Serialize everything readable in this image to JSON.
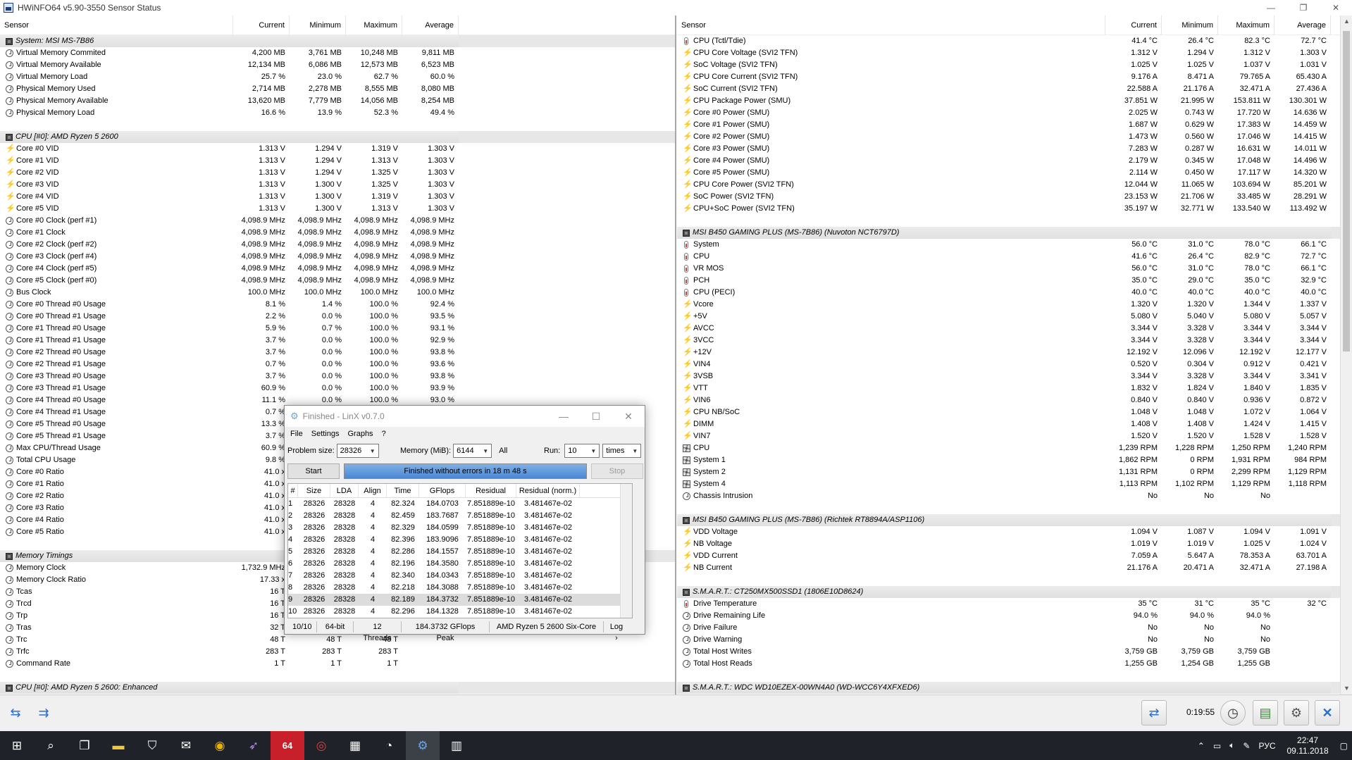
{
  "window": {
    "title": "HWiNFO64 v5.90-3550 Sensor Status",
    "buttons": [
      "—",
      "❐",
      "✕"
    ]
  },
  "columns": [
    "Sensor",
    "Current",
    "Minimum",
    "Maximum",
    "Average"
  ],
  "left_rows": [
    {
      "type": "section",
      "label": "System: MSI MS-7B86",
      "icon": "chip"
    },
    {
      "label": "Virtual Memory Commited",
      "icon": "clock",
      "v": [
        "4,200 MB",
        "3,761 MB",
        "10,248 MB",
        "9,811 MB"
      ]
    },
    {
      "label": "Virtual Memory Available",
      "icon": "clock",
      "v": [
        "12,134 MB",
        "6,086 MB",
        "12,573 MB",
        "6,523 MB"
      ]
    },
    {
      "label": "Virtual Memory Load",
      "icon": "clock",
      "v": [
        "25.7 %",
        "23.0 %",
        "62.7 %",
        "60.0 %"
      ]
    },
    {
      "label": "Physical Memory Used",
      "icon": "clock",
      "v": [
        "2,714 MB",
        "2,278 MB",
        "8,555 MB",
        "8,080 MB"
      ]
    },
    {
      "label": "Physical Memory Available",
      "icon": "clock",
      "v": [
        "13,620 MB",
        "7,779 MB",
        "14,056 MB",
        "8,254 MB"
      ]
    },
    {
      "label": "Physical Memory Load",
      "icon": "clock",
      "v": [
        "16.6 %",
        "13.9 %",
        "52.3 %",
        "49.4 %"
      ]
    },
    {
      "type": "blank"
    },
    {
      "type": "section",
      "label": "CPU [#0]: AMD Ryzen 5 2600",
      "icon": "chip"
    },
    {
      "label": "Core #0 VID",
      "icon": "bolt",
      "v": [
        "1.313 V",
        "1.294 V",
        "1.319 V",
        "1.303 V"
      ]
    },
    {
      "label": "Core #1 VID",
      "icon": "bolt",
      "v": [
        "1.313 V",
        "1.294 V",
        "1.313 V",
        "1.303 V"
      ]
    },
    {
      "label": "Core #2 VID",
      "icon": "bolt",
      "v": [
        "1.313 V",
        "1.294 V",
        "1.325 V",
        "1.303 V"
      ]
    },
    {
      "label": "Core #3 VID",
      "icon": "bolt",
      "v": [
        "1.313 V",
        "1.300 V",
        "1.325 V",
        "1.303 V"
      ]
    },
    {
      "label": "Core #4 VID",
      "icon": "bolt",
      "v": [
        "1.313 V",
        "1.300 V",
        "1.319 V",
        "1.303 V"
      ]
    },
    {
      "label": "Core #5 VID",
      "icon": "bolt",
      "v": [
        "1.313 V",
        "1.300 V",
        "1.313 V",
        "1.303 V"
      ]
    },
    {
      "label": "Core #0 Clock (perf #1)",
      "icon": "clock",
      "v": [
        "4,098.9 MHz",
        "4,098.9 MHz",
        "4,098.9 MHz",
        "4,098.9 MHz"
      ]
    },
    {
      "label": "Core #1 Clock",
      "icon": "clock",
      "v": [
        "4,098.9 MHz",
        "4,098.9 MHz",
        "4,098.9 MHz",
        "4,098.9 MHz"
      ]
    },
    {
      "label": "Core #2 Clock (perf #2)",
      "icon": "clock",
      "v": [
        "4,098.9 MHz",
        "4,098.9 MHz",
        "4,098.9 MHz",
        "4,098.9 MHz"
      ]
    },
    {
      "label": "Core #3 Clock (perf #4)",
      "icon": "clock",
      "v": [
        "4,098.9 MHz",
        "4,098.9 MHz",
        "4,098.9 MHz",
        "4,098.9 MHz"
      ]
    },
    {
      "label": "Core #4 Clock (perf #5)",
      "icon": "clock",
      "v": [
        "4,098.9 MHz",
        "4,098.9 MHz",
        "4,098.9 MHz",
        "4,098.9 MHz"
      ]
    },
    {
      "label": "Core #5 Clock (perf #0)",
      "icon": "clock",
      "v": [
        "4,098.9 MHz",
        "4,098.9 MHz",
        "4,098.9 MHz",
        "4,098.9 MHz"
      ]
    },
    {
      "label": "Bus Clock",
      "icon": "clock",
      "v": [
        "100.0 MHz",
        "100.0 MHz",
        "100.0 MHz",
        "100.0 MHz"
      ]
    },
    {
      "label": "Core #0 Thread #0 Usage",
      "icon": "clock",
      "v": [
        "8.1 %",
        "1.4 %",
        "100.0 %",
        "92.4 %"
      ]
    },
    {
      "label": "Core #0 Thread #1 Usage",
      "icon": "clock",
      "v": [
        "2.2 %",
        "0.0 %",
        "100.0 %",
        "93.5 %"
      ]
    },
    {
      "label": "Core #1 Thread #0 Usage",
      "icon": "clock",
      "v": [
        "5.9 %",
        "0.7 %",
        "100.0 %",
        "93.1 %"
      ]
    },
    {
      "label": "Core #1 Thread #1 Usage",
      "icon": "clock",
      "v": [
        "3.7 %",
        "0.0 %",
        "100.0 %",
        "92.9 %"
      ]
    },
    {
      "label": "Core #2 Thread #0 Usage",
      "icon": "clock",
      "v": [
        "3.7 %",
        "0.0 %",
        "100.0 %",
        "93.8 %"
      ]
    },
    {
      "label": "Core #2 Thread #1 Usage",
      "icon": "clock",
      "v": [
        "0.7 %",
        "0.0 %",
        "100.0 %",
        "93.6 %"
      ]
    },
    {
      "label": "Core #3 Thread #0 Usage",
      "icon": "clock",
      "v": [
        "3.7 %",
        "0.0 %",
        "100.0 %",
        "93.8 %"
      ]
    },
    {
      "label": "Core #3 Thread #1 Usage",
      "icon": "clock",
      "v": [
        "60.9 %",
        "0.0 %",
        "100.0 %",
        "93.9 %"
      ]
    },
    {
      "label": "Core #4 Thread #0 Usage",
      "icon": "clock",
      "v": [
        "11.1 %",
        "0.0 %",
        "100.0 %",
        "93.0 %"
      ]
    },
    {
      "label": "Core #4 Thread #1 Usage",
      "icon": "clock",
      "v": [
        "0.7 %",
        "",
        "",
        ""
      ]
    },
    {
      "label": "Core #5 Thread #0 Usage",
      "icon": "clock",
      "v": [
        "13.3 %",
        "",
        "",
        ""
      ]
    },
    {
      "label": "Core #5 Thread #1 Usage",
      "icon": "clock",
      "v": [
        "3.7 %",
        "",
        "",
        ""
      ]
    },
    {
      "label": "Max CPU/Thread Usage",
      "icon": "clock",
      "v": [
        "60.9 %",
        "",
        "",
        ""
      ]
    },
    {
      "label": "Total CPU Usage",
      "icon": "clock",
      "v": [
        "9.8 %",
        "",
        "",
        ""
      ]
    },
    {
      "label": "Core #0 Ratio",
      "icon": "clock",
      "v": [
        "41.0 x",
        "",
        "",
        ""
      ]
    },
    {
      "label": "Core #1 Ratio",
      "icon": "clock",
      "v": [
        "41.0 x",
        "",
        "",
        ""
      ]
    },
    {
      "label": "Core #2 Ratio",
      "icon": "clock",
      "v": [
        "41.0 x",
        "",
        "",
        ""
      ]
    },
    {
      "label": "Core #3 Ratio",
      "icon": "clock",
      "v": [
        "41.0 x",
        "",
        "",
        ""
      ]
    },
    {
      "label": "Core #4 Ratio",
      "icon": "clock",
      "v": [
        "41.0 x",
        "",
        "",
        ""
      ]
    },
    {
      "label": "Core #5 Ratio",
      "icon": "clock",
      "v": [
        "41.0 x",
        "",
        "",
        ""
      ]
    },
    {
      "type": "blank"
    },
    {
      "type": "section",
      "label": "Memory Timings",
      "icon": "chip"
    },
    {
      "label": "Memory Clock",
      "icon": "clock",
      "v": [
        "1,732.9 MHz",
        "",
        "",
        ""
      ]
    },
    {
      "label": "Memory Clock Ratio",
      "icon": "clock",
      "v": [
        "17.33 x",
        "",
        "",
        ""
      ]
    },
    {
      "label": "Tcas",
      "icon": "clock",
      "v": [
        "16 T",
        "",
        "",
        ""
      ]
    },
    {
      "label": "Trcd",
      "icon": "clock",
      "v": [
        "16 T",
        "",
        "",
        ""
      ]
    },
    {
      "label": "Trp",
      "icon": "clock",
      "v": [
        "16 T",
        "",
        "",
        ""
      ]
    },
    {
      "label": "Tras",
      "icon": "clock",
      "v": [
        "32 T",
        "",
        "",
        ""
      ]
    },
    {
      "label": "Trc",
      "icon": "clock",
      "v": [
        "48 T",
        "48 T",
        "48 T",
        ""
      ]
    },
    {
      "label": "Trfc",
      "icon": "clock",
      "v": [
        "283 T",
        "283 T",
        "283 T",
        ""
      ]
    },
    {
      "label": "Command Rate",
      "icon": "clock",
      "v": [
        "1 T",
        "1 T",
        "1 T",
        ""
      ]
    },
    {
      "type": "blank"
    },
    {
      "type": "section",
      "label": "CPU [#0]: AMD Ryzen 5 2600: Enhanced",
      "icon": "chip"
    }
  ],
  "right_rows": [
    {
      "label": "CPU (Tctl/Tdie)",
      "icon": "therm",
      "v": [
        "41.4 °C",
        "26.4 °C",
        "82.3 °C",
        "72.7 °C"
      ]
    },
    {
      "label": "CPU Core Voltage (SVI2 TFN)",
      "icon": "bolt",
      "v": [
        "1.312 V",
        "1.294 V",
        "1.312 V",
        "1.303 V"
      ]
    },
    {
      "label": "SoC Voltage (SVI2 TFN)",
      "icon": "bolt",
      "v": [
        "1.025 V",
        "1.025 V",
        "1.037 V",
        "1.031 V"
      ]
    },
    {
      "label": "CPU Core Current (SVI2 TFN)",
      "icon": "bolt",
      "v": [
        "9.176 A",
        "8.471 A",
        "79.765 A",
        "65.430 A"
      ]
    },
    {
      "label": "SoC Current (SVI2 TFN)",
      "icon": "bolt",
      "v": [
        "22.588 A",
        "21.176 A",
        "32.471 A",
        "27.436 A"
      ]
    },
    {
      "label": "CPU Package Power (SMU)",
      "icon": "bolt",
      "v": [
        "37.851 W",
        "21.995 W",
        "153.811 W",
        "130.301 W"
      ]
    },
    {
      "label": "Core #0 Power (SMU)",
      "icon": "bolt",
      "v": [
        "2.025 W",
        "0.743 W",
        "17.720 W",
        "14.636 W"
      ]
    },
    {
      "label": "Core #1 Power (SMU)",
      "icon": "bolt",
      "v": [
        "1.687 W",
        "0.629 W",
        "17.383 W",
        "14.459 W"
      ]
    },
    {
      "label": "Core #2 Power (SMU)",
      "icon": "bolt",
      "v": [
        "1.473 W",
        "0.560 W",
        "17.046 W",
        "14.415 W"
      ]
    },
    {
      "label": "Core #3 Power (SMU)",
      "icon": "bolt",
      "v": [
        "7.283 W",
        "0.287 W",
        "16.631 W",
        "14.011 W"
      ]
    },
    {
      "label": "Core #4 Power (SMU)",
      "icon": "bolt",
      "v": [
        "2.179 W",
        "0.345 W",
        "17.048 W",
        "14.496 W"
      ]
    },
    {
      "label": "Core #5 Power (SMU)",
      "icon": "bolt",
      "v": [
        "2.114 W",
        "0.450 W",
        "17.117 W",
        "14.320 W"
      ]
    },
    {
      "label": "CPU Core Power (SVI2 TFN)",
      "icon": "bolt",
      "v": [
        "12.044 W",
        "11.065 W",
        "103.694 W",
        "85.201 W"
      ]
    },
    {
      "label": "SoC Power (SVI2 TFN)",
      "icon": "bolt",
      "v": [
        "23.153 W",
        "21.706 W",
        "33.485 W",
        "28.291 W"
      ]
    },
    {
      "label": "CPU+SoC Power (SVI2 TFN)",
      "icon": "bolt",
      "v": [
        "35.197 W",
        "32.771 W",
        "133.540 W",
        "113.492 W"
      ]
    },
    {
      "type": "blank"
    },
    {
      "type": "section",
      "label": "MSI B450 GAMING PLUS (MS-7B86) (Nuvoton NCT6797D)",
      "icon": "chip"
    },
    {
      "label": "System",
      "icon": "therm",
      "v": [
        "56.0 °C",
        "31.0 °C",
        "78.0 °C",
        "66.1 °C"
      ]
    },
    {
      "label": "CPU",
      "icon": "therm",
      "v": [
        "41.6 °C",
        "26.4 °C",
        "82.9 °C",
        "72.7 °C"
      ]
    },
    {
      "label": "VR MOS",
      "icon": "therm",
      "v": [
        "56.0 °C",
        "31.0 °C",
        "78.0 °C",
        "66.1 °C"
      ]
    },
    {
      "label": "PCH",
      "icon": "therm",
      "v": [
        "35.0 °C",
        "29.0 °C",
        "35.0 °C",
        "32.9 °C"
      ]
    },
    {
      "label": "CPU (PECI)",
      "icon": "therm",
      "v": [
        "40.0 °C",
        "40.0 °C",
        "40.0 °C",
        "40.0 °C"
      ]
    },
    {
      "label": "Vcore",
      "icon": "bolt",
      "v": [
        "1.320 V",
        "1.320 V",
        "1.344 V",
        "1.337 V"
      ]
    },
    {
      "label": "+5V",
      "icon": "bolt",
      "v": [
        "5.080 V",
        "5.040 V",
        "5.080 V",
        "5.057 V"
      ]
    },
    {
      "label": "AVCC",
      "icon": "bolt",
      "v": [
        "3.344 V",
        "3.328 V",
        "3.344 V",
        "3.344 V"
      ]
    },
    {
      "label": "3VCC",
      "icon": "bolt",
      "v": [
        "3.344 V",
        "3.328 V",
        "3.344 V",
        "3.344 V"
      ]
    },
    {
      "label": "+12V",
      "icon": "bolt",
      "v": [
        "12.192 V",
        "12.096 V",
        "12.192 V",
        "12.177 V"
      ]
    },
    {
      "label": "VIN4",
      "icon": "bolt",
      "v": [
        "0.520 V",
        "0.304 V",
        "0.912 V",
        "0.421 V"
      ]
    },
    {
      "label": "3VSB",
      "icon": "bolt",
      "v": [
        "3.344 V",
        "3.328 V",
        "3.344 V",
        "3.341 V"
      ]
    },
    {
      "label": "VTT",
      "icon": "bolt",
      "v": [
        "1.832 V",
        "1.824 V",
        "1.840 V",
        "1.835 V"
      ]
    },
    {
      "label": "VIN6",
      "icon": "bolt",
      "v": [
        "0.840 V",
        "0.840 V",
        "0.936 V",
        "0.872 V"
      ]
    },
    {
      "label": "CPU NB/SoC",
      "icon": "bolt",
      "v": [
        "1.048 V",
        "1.048 V",
        "1.072 V",
        "1.064 V"
      ]
    },
    {
      "label": "DIMM",
      "icon": "bolt",
      "v": [
        "1.408 V",
        "1.408 V",
        "1.424 V",
        "1.415 V"
      ]
    },
    {
      "label": "VIN7",
      "icon": "bolt",
      "v": [
        "1.520 V",
        "1.520 V",
        "1.528 V",
        "1.528 V"
      ]
    },
    {
      "label": "CPU",
      "icon": "fan",
      "v": [
        "1,239 RPM",
        "1,228 RPM",
        "1,250 RPM",
        "1,240 RPM"
      ]
    },
    {
      "label": "System 1",
      "icon": "fan",
      "v": [
        "1,862 RPM",
        "0 RPM",
        "1,931 RPM",
        "984 RPM"
      ]
    },
    {
      "label": "System 2",
      "icon": "fan",
      "v": [
        "1,131 RPM",
        "0 RPM",
        "2,299 RPM",
        "1,129 RPM"
      ]
    },
    {
      "label": "System 4",
      "icon": "fan",
      "v": [
        "1,113 RPM",
        "1,102 RPM",
        "1,129 RPM",
        "1,118 RPM"
      ]
    },
    {
      "label": "Chassis Intrusion",
      "icon": "clock",
      "v": [
        "No",
        "No",
        "No",
        ""
      ]
    },
    {
      "type": "blank"
    },
    {
      "type": "section",
      "label": "MSI B450 GAMING PLUS (MS-7B86) (Richtek RT8894A/ASP1106)",
      "icon": "chip"
    },
    {
      "label": "VDD Voltage",
      "icon": "bolt",
      "v": [
        "1.094 V",
        "1.087 V",
        "1.094 V",
        "1.091 V"
      ]
    },
    {
      "label": "NB Voltage",
      "icon": "bolt",
      "v": [
        "1.019 V",
        "1.019 V",
        "1.025 V",
        "1.024 V"
      ]
    },
    {
      "label": "VDD Current",
      "icon": "bolt",
      "v": [
        "7.059 A",
        "5.647 A",
        "78.353 A",
        "63.701 A"
      ]
    },
    {
      "label": "NB Current",
      "icon": "bolt",
      "v": [
        "21.176 A",
        "20.471 A",
        "32.471 A",
        "27.198 A"
      ]
    },
    {
      "type": "blank"
    },
    {
      "type": "section",
      "label": "S.M.A.R.T.: CT250MX500SSD1 (1806E10D8624)",
      "icon": "chip"
    },
    {
      "label": "Drive Temperature",
      "icon": "therm",
      "v": [
        "35 °C",
        "31 °C",
        "35 °C",
        "32 °C"
      ]
    },
    {
      "label": "Drive Remaining Life",
      "icon": "clock",
      "v": [
        "94.0 %",
        "94.0 %",
        "94.0 %",
        ""
      ]
    },
    {
      "label": "Drive Failure",
      "icon": "clock",
      "v": [
        "No",
        "No",
        "No",
        ""
      ]
    },
    {
      "label": "Drive Warning",
      "icon": "clock",
      "v": [
        "No",
        "No",
        "No",
        ""
      ]
    },
    {
      "label": "Total Host Writes",
      "icon": "clock",
      "v": [
        "3,759 GB",
        "3,759 GB",
        "3,759 GB",
        ""
      ]
    },
    {
      "label": "Total Host Reads",
      "icon": "clock",
      "v": [
        "1,255 GB",
        "1,254 GB",
        "1,255 GB",
        ""
      ]
    },
    {
      "type": "blank"
    },
    {
      "type": "section",
      "label": "S.M.A.R.T.: WDC WD10EZEX-00WN4A0 (WD-WCC6Y4XFXED6)",
      "icon": "chip"
    }
  ],
  "toolbar": {
    "timer": "0:19:55"
  },
  "linx": {
    "title": "Finished - LinX v0.7.0",
    "menu": [
      "File",
      "Settings",
      "Graphs",
      "?"
    ],
    "problem_size_label": "Problem size:",
    "problem_size": "28326",
    "memory_label": "Memory (MiB):",
    "memory": "6144",
    "all_label": "All",
    "run_label": "Run:",
    "run": "10",
    "times": "times",
    "start": "Start",
    "stop": "Stop",
    "status": "Finished without errors in 18 m 48 s",
    "progress": 1.0,
    "headers": [
      "#",
      "Size",
      "LDA",
      "Align",
      "Time",
      "GFlops",
      "Residual",
      "Residual (norm.)"
    ],
    "rows": [
      [
        "1",
        "28326",
        "28328",
        "4",
        "82.324",
        "184.0703",
        "7.851889e-10",
        "3.481467e-02"
      ],
      [
        "2",
        "28326",
        "28328",
        "4",
        "82.459",
        "183.7687",
        "7.851889e-10",
        "3.481467e-02"
      ],
      [
        "3",
        "28326",
        "28328",
        "4",
        "82.329",
        "184.0599",
        "7.851889e-10",
        "3.481467e-02"
      ],
      [
        "4",
        "28326",
        "28328",
        "4",
        "82.396",
        "183.9096",
        "7.851889e-10",
        "3.481467e-02"
      ],
      [
        "5",
        "28326",
        "28328",
        "4",
        "82.286",
        "184.1557",
        "7.851889e-10",
        "3.481467e-02"
      ],
      [
        "6",
        "28326",
        "28328",
        "4",
        "82.196",
        "184.3580",
        "7.851889e-10",
        "3.481467e-02"
      ],
      [
        "7",
        "28326",
        "28328",
        "4",
        "82.340",
        "184.0343",
        "7.851889e-10",
        "3.481467e-02"
      ],
      [
        "8",
        "28326",
        "28328",
        "4",
        "82.218",
        "184.3088",
        "7.851889e-10",
        "3.481467e-02"
      ],
      [
        "9",
        "28326",
        "28328",
        "4",
        "82.189",
        "184.3732",
        "7.851889e-10",
        "3.481467e-02"
      ],
      [
        "10",
        "28326",
        "28328",
        "4",
        "82.296",
        "184.1328",
        "7.851889e-10",
        "3.481467e-02"
      ]
    ],
    "footer": [
      "10/10",
      "64-bit",
      "12 Threads",
      "184.3732 GFlops Peak",
      "AMD Ryzen 5 2600 Six-Core",
      "Log ›"
    ]
  },
  "taskbar": {
    "lang": "РУС",
    "time": "22:47",
    "date": "09.11.2018",
    "hwinfo_label": "64"
  }
}
